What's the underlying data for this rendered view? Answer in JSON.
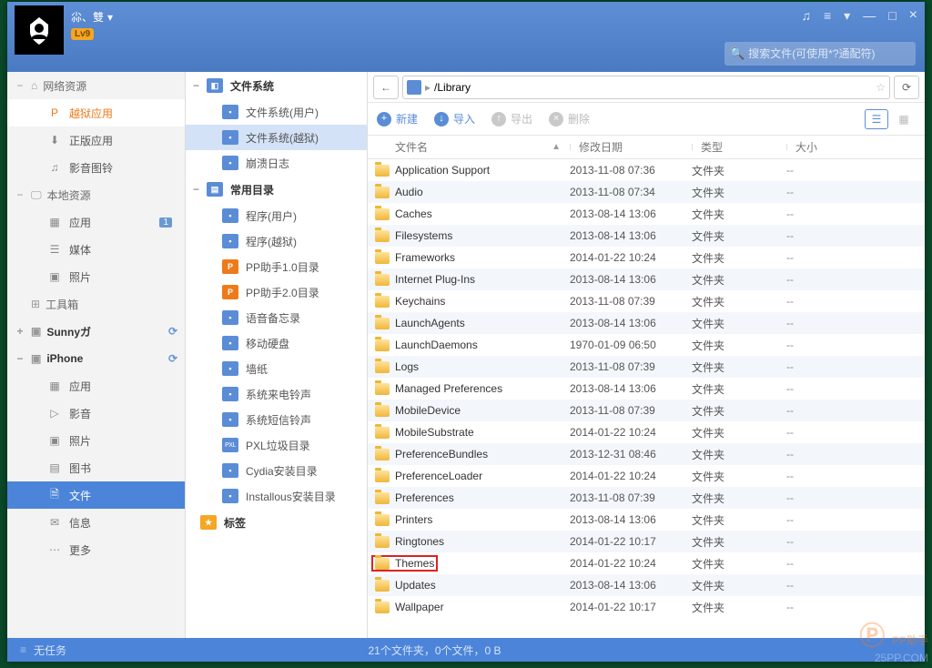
{
  "user": {
    "name": "尛、雙",
    "level": "Lv9"
  },
  "title_controls": {
    "music": "♫",
    "feedback": "≡",
    "dropdown": "▾",
    "minimize": "—",
    "maximize": "□",
    "close": "×"
  },
  "search": {
    "placeholder": "搜索文件(可使用*?通配符)"
  },
  "sidebar": {
    "groups": [
      {
        "icon": "⌂",
        "label": "网络资源",
        "toggle": "−",
        "items": [
          {
            "icon": "P",
            "label": "越狱应用",
            "active": true
          },
          {
            "icon": "⬇",
            "label": "正版应用"
          },
          {
            "icon": "♫",
            "label": "影音图铃"
          }
        ]
      },
      {
        "icon": "🖵",
        "label": "本地资源",
        "toggle": "−",
        "items": [
          {
            "icon": "▦",
            "label": "应用",
            "badge": "1"
          },
          {
            "icon": "☰",
            "label": "媒体"
          },
          {
            "icon": "▣",
            "label": "照片"
          }
        ]
      },
      {
        "icon": "⊞",
        "label": "工具箱",
        "toggle": "",
        "items": []
      },
      {
        "icon": "▣",
        "label": "Sunnyガ",
        "toggle": "+",
        "sync": "⟳",
        "device": true,
        "items": []
      },
      {
        "icon": "▣",
        "label": "iPhone",
        "toggle": "−",
        "sync": "⟳",
        "device": true,
        "items": [
          {
            "icon": "▦",
            "label": "应用"
          },
          {
            "icon": "▷",
            "label": "影音"
          },
          {
            "icon": "▣",
            "label": "照片"
          },
          {
            "icon": "▤",
            "label": "图书"
          },
          {
            "icon": "🗎",
            "label": "文件",
            "active_blue": true
          },
          {
            "icon": "✉",
            "label": "信息"
          },
          {
            "icon": "⋯",
            "label": "更多"
          }
        ]
      }
    ]
  },
  "mid": {
    "sections": [
      {
        "label": "文件系统",
        "toggle": "−",
        "icon": "◧",
        "items": [
          {
            "ico": "fs",
            "label": "文件系统(用户)"
          },
          {
            "ico": "fs",
            "label": "文件系统(越狱)",
            "selected": true
          },
          {
            "ico": "log",
            "label": "崩溃日志"
          }
        ]
      },
      {
        "label": "常用目录",
        "toggle": "−",
        "icon": "▤",
        "items": [
          {
            "ico": "app",
            "label": "程序(用户)"
          },
          {
            "ico": "app",
            "label": "程序(越狱)"
          },
          {
            "ico": "pp",
            "label": "PP助手1.0目录"
          },
          {
            "ico": "pp",
            "label": "PP助手2.0目录"
          },
          {
            "ico": "voice",
            "label": "语音备忘录"
          },
          {
            "ico": "hdd",
            "label": "移动硬盘"
          },
          {
            "ico": "wall",
            "label": "墙纸"
          },
          {
            "ico": "ring",
            "label": "系统来电铃声"
          },
          {
            "ico": "ring",
            "label": "系统短信铃声"
          },
          {
            "ico": "pxl",
            "label": "PXL垃圾目录"
          },
          {
            "ico": "cydia",
            "label": "Cydia安装目录"
          },
          {
            "ico": "inst",
            "label": "Installous安装目录"
          }
        ]
      },
      {
        "label": "标签",
        "toggle": "",
        "icon": "★",
        "items": []
      }
    ]
  },
  "pathbar": {
    "path": "/Library"
  },
  "toolbar": {
    "new": "新建",
    "import": "导入",
    "export": "导出",
    "delete": "删除"
  },
  "columns": {
    "name": "文件名",
    "date": "修改日期",
    "type": "类型",
    "size": "大小"
  },
  "files": [
    {
      "name": "Application Support",
      "date": "2013-11-08 07:36",
      "type": "文件夹",
      "size": "--"
    },
    {
      "name": "Audio",
      "date": "2013-11-08 07:34",
      "type": "文件夹",
      "size": "--"
    },
    {
      "name": "Caches",
      "date": "2013-08-14 13:06",
      "type": "文件夹",
      "size": "--"
    },
    {
      "name": "Filesystems",
      "date": "2013-08-14 13:06",
      "type": "文件夹",
      "size": "--"
    },
    {
      "name": "Frameworks",
      "date": "2014-01-22 10:24",
      "type": "文件夹",
      "size": "--"
    },
    {
      "name": "Internet Plug-Ins",
      "date": "2013-08-14 13:06",
      "type": "文件夹",
      "size": "--"
    },
    {
      "name": "Keychains",
      "date": "2013-11-08 07:39",
      "type": "文件夹",
      "size": "--"
    },
    {
      "name": "LaunchAgents",
      "date": "2013-08-14 13:06",
      "type": "文件夹",
      "size": "--"
    },
    {
      "name": "LaunchDaemons",
      "date": "1970-01-09 06:50",
      "type": "文件夹",
      "size": "--"
    },
    {
      "name": "Logs",
      "date": "2013-11-08 07:39",
      "type": "文件夹",
      "size": "--"
    },
    {
      "name": "Managed Preferences",
      "date": "2013-08-14 13:06",
      "type": "文件夹",
      "size": "--"
    },
    {
      "name": "MobileDevice",
      "date": "2013-11-08 07:39",
      "type": "文件夹",
      "size": "--"
    },
    {
      "name": "MobileSubstrate",
      "date": "2014-01-22 10:24",
      "type": "文件夹",
      "size": "--"
    },
    {
      "name": "PreferenceBundles",
      "date": "2013-12-31 08:46",
      "type": "文件夹",
      "size": "--"
    },
    {
      "name": "PreferenceLoader",
      "date": "2014-01-22 10:24",
      "type": "文件夹",
      "size": "--"
    },
    {
      "name": "Preferences",
      "date": "2013-11-08 07:39",
      "type": "文件夹",
      "size": "--"
    },
    {
      "name": "Printers",
      "date": "2013-08-14 13:06",
      "type": "文件夹",
      "size": "--"
    },
    {
      "name": "Ringtones",
      "date": "2014-01-22 10:17",
      "type": "文件夹",
      "size": "--"
    },
    {
      "name": "Themes",
      "date": "2014-01-22 10:24",
      "type": "文件夹",
      "size": "--",
      "highlight": true
    },
    {
      "name": "Updates",
      "date": "2013-08-14 13:06",
      "type": "文件夹",
      "size": "--"
    },
    {
      "name": "Wallpaper",
      "date": "2014-01-22 10:17",
      "type": "文件夹",
      "size": "--"
    }
  ],
  "status": {
    "tasks": "无任务",
    "summary": "21个文件夹，0个文件，0 B"
  },
  "watermark": {
    "brand": "PP助手",
    "url": "25PP.COM"
  }
}
